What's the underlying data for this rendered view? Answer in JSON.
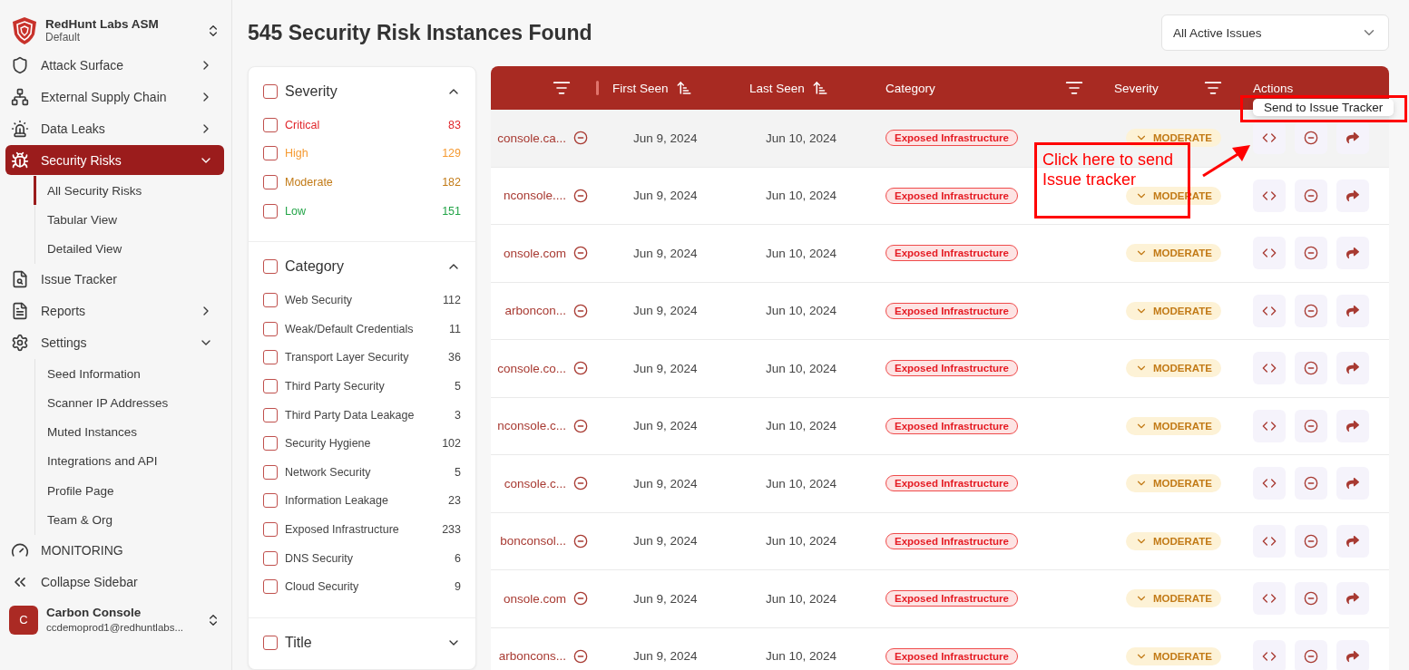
{
  "workspace": {
    "name": "RedHunt Labs ASM",
    "subtitle": "Default"
  },
  "nav": [
    {
      "label": "Attack Surface",
      "expanded": false,
      "selected": false
    },
    {
      "label": "External Supply Chain",
      "expanded": false,
      "selected": false
    },
    {
      "label": "Data Leaks",
      "expanded": false,
      "selected": false
    },
    {
      "label": "Security Risks",
      "expanded": true,
      "selected": true,
      "children": [
        {
          "label": "All Security Risks",
          "selected": true
        },
        {
          "label": "Tabular View",
          "selected": false
        },
        {
          "label": "Detailed View",
          "selected": false
        }
      ]
    },
    {
      "label": "Issue Tracker",
      "selected": false
    },
    {
      "label": "Reports",
      "expanded": false,
      "selected": false
    },
    {
      "label": "Settings",
      "expanded": true,
      "selected": false,
      "children": [
        {
          "label": "Seed Information",
          "selected": false
        },
        {
          "label": "Scanner IP Addresses",
          "selected": false
        },
        {
          "label": "Muted Instances",
          "selected": false
        },
        {
          "label": "Integrations and API",
          "selected": false
        },
        {
          "label": "Profile Page",
          "selected": false
        },
        {
          "label": "Team & Org",
          "selected": false
        }
      ]
    },
    {
      "label": "MONITORING",
      "selected": false
    }
  ],
  "collapse_label": "Collapse Sidebar",
  "account": {
    "initial": "C",
    "name": "Carbon Console",
    "email": "ccdemoprod1@redhuntlabs..."
  },
  "page_title": "545 Security Risk Instances Found",
  "view_select": {
    "value": "All Active Issues"
  },
  "filters": [
    {
      "title": "Severity",
      "checked": false,
      "expanded": true,
      "options": [
        {
          "label": "Critical",
          "count": "83",
          "color": "#e0262b",
          "checked": false
        },
        {
          "label": "High",
          "count": "129",
          "color": "#f59a32",
          "checked": false
        },
        {
          "label": "Moderate",
          "count": "182",
          "color": "#c27a16",
          "checked": false
        },
        {
          "label": "Low",
          "count": "151",
          "color": "#22a447",
          "checked": false
        }
      ]
    },
    {
      "title": "Category",
      "checked": false,
      "expanded": true,
      "options": [
        {
          "label": "Web Security",
          "count": "112",
          "checked": false
        },
        {
          "label": "Weak/Default Credentials",
          "count": "11",
          "checked": false
        },
        {
          "label": "Transport Layer Security",
          "count": "36",
          "checked": false
        },
        {
          "label": "Third Party Security",
          "count": "5",
          "checked": false
        },
        {
          "label": "Third Party Data Leakage",
          "count": "3",
          "checked": false
        },
        {
          "label": "Security Hygiene",
          "count": "102",
          "checked": false
        },
        {
          "label": "Network Security",
          "count": "5",
          "checked": false
        },
        {
          "label": "Information Leakage",
          "count": "23",
          "checked": false
        },
        {
          "label": "Exposed Infrastructure",
          "count": "233",
          "checked": false
        },
        {
          "label": "DNS Security",
          "count": "6",
          "checked": false
        },
        {
          "label": "Cloud Security",
          "count": "9",
          "checked": false
        }
      ]
    },
    {
      "title": "Title",
      "checked": false,
      "expanded": false
    }
  ],
  "table": {
    "columns": [
      {
        "kind": "filter"
      },
      {
        "label": "First Seen",
        "kind": "sort"
      },
      {
        "label": "Last Seen",
        "kind": "sort"
      },
      {
        "label": "Category",
        "kind": "filter"
      },
      {
        "label": "Severity",
        "kind": "filter"
      },
      {
        "label": "Actions",
        "kind": "plain"
      }
    ],
    "rows": [
      {
        "asset": "console.ca...",
        "first_seen": "Jun 9, 2024",
        "last_seen": "Jun 10, 2024",
        "category": "Exposed Infrastructure",
        "severity": "MODERATE",
        "hovered": true
      },
      {
        "asset": "nconsole....",
        "first_seen": "Jun 9, 2024",
        "last_seen": "Jun 10, 2024",
        "category": "Exposed Infrastructure",
        "severity": "MODERATE",
        "hovered": false
      },
      {
        "asset": "onsole.com",
        "first_seen": "Jun 9, 2024",
        "last_seen": "Jun 10, 2024",
        "category": "Exposed Infrastructure",
        "severity": "MODERATE",
        "hovered": false
      },
      {
        "asset": "arboncon...",
        "first_seen": "Jun 9, 2024",
        "last_seen": "Jun 10, 2024",
        "category": "Exposed Infrastructure",
        "severity": "MODERATE",
        "hovered": false
      },
      {
        "asset": "console.co...",
        "first_seen": "Jun 9, 2024",
        "last_seen": "Jun 10, 2024",
        "category": "Exposed Infrastructure",
        "severity": "MODERATE",
        "hovered": false
      },
      {
        "asset": "nconsole.c...",
        "first_seen": "Jun 9, 2024",
        "last_seen": "Jun 10, 2024",
        "category": "Exposed Infrastructure",
        "severity": "MODERATE",
        "hovered": false
      },
      {
        "asset": "console.c...",
        "first_seen": "Jun 9, 2024",
        "last_seen": "Jun 10, 2024",
        "category": "Exposed Infrastructure",
        "severity": "MODERATE",
        "hovered": false
      },
      {
        "asset": "bonconsol...",
        "first_seen": "Jun 9, 2024",
        "last_seen": "Jun 10, 2024",
        "category": "Exposed Infrastructure",
        "severity": "MODERATE",
        "hovered": false
      },
      {
        "asset": "onsole.com",
        "first_seen": "Jun 9, 2024",
        "last_seen": "Jun 10, 2024",
        "category": "Exposed Infrastructure",
        "severity": "MODERATE",
        "hovered": false
      },
      {
        "asset": "arboncons...",
        "first_seen": "Jun 9, 2024",
        "last_seen": "Jun 10, 2024",
        "category": "Exposed Infrastructure",
        "severity": "MODERATE",
        "hovered": false
      }
    ]
  },
  "tooltip": "Send to Issue Tracker",
  "annotation": "Click here to send\nIssue tracker"
}
